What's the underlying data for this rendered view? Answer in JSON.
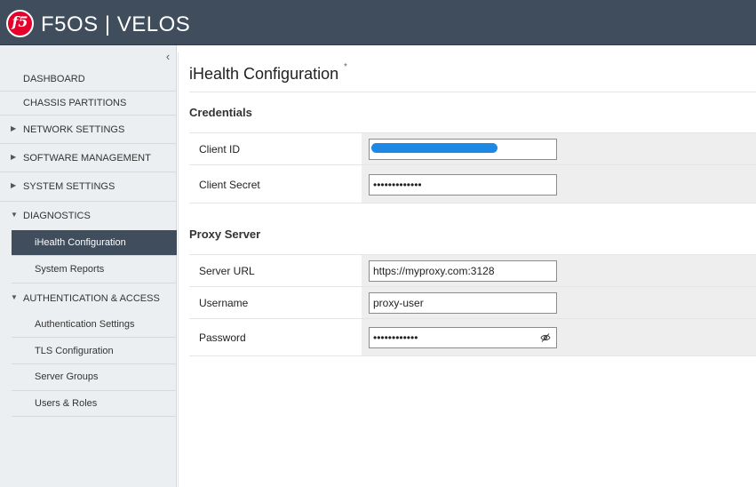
{
  "header": {
    "brand": "F5OS | VELOS",
    "logo_text": "f5"
  },
  "sidebar": {
    "collapse_icon": "chevron-left-icon",
    "items": [
      {
        "label": "DASHBOARD"
      },
      {
        "label": "CHASSIS PARTITIONS"
      },
      {
        "label": "NETWORK SETTINGS",
        "expanded": false
      },
      {
        "label": "SOFTWARE MANAGEMENT",
        "expanded": false
      },
      {
        "label": "SYSTEM SETTINGS",
        "expanded": false
      },
      {
        "label": "DIAGNOSTICS",
        "expanded": true
      },
      {
        "label": "AUTHENTICATION & ACCESS",
        "expanded": true
      }
    ],
    "diagnostics_children": [
      {
        "label": "iHealth Configuration",
        "active": true
      },
      {
        "label": "System Reports"
      }
    ],
    "auth_children": [
      {
        "label": "Authentication Settings"
      },
      {
        "label": "TLS Configuration"
      },
      {
        "label": "Server Groups"
      },
      {
        "label": "Users & Roles"
      }
    ]
  },
  "main": {
    "title": "iHealth Configuration",
    "required_mark": "*",
    "credentials": {
      "heading": "Credentials",
      "client_id_label": "Client ID",
      "client_id_value": "",
      "client_secret_label": "Client Secret",
      "client_secret_value": "•••••••••••••"
    },
    "proxy": {
      "heading": "Proxy Server",
      "server_url_label": "Server URL",
      "server_url_value": "https://myproxy.com:3128",
      "username_label": "Username",
      "username_value": "proxy-user",
      "password_label": "Password",
      "password_value": "••••••••••••",
      "password_toggle_icon": "eye-off-icon"
    }
  },
  "colors": {
    "header_bg": "#3f4d5c",
    "active_nav_bg": "#3f4d5c",
    "logo_red": "#e4002b",
    "redaction": "#1e88e5"
  }
}
